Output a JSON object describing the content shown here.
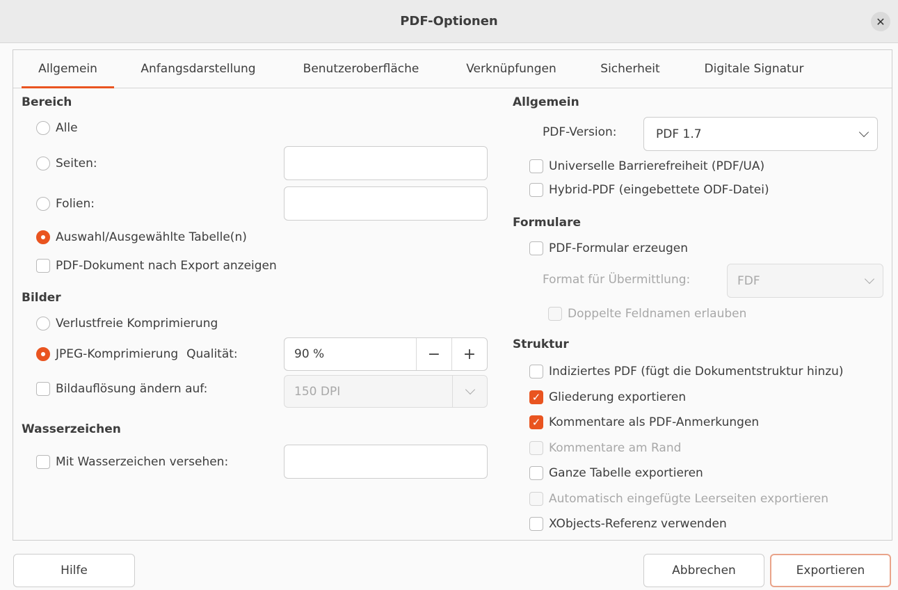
{
  "dialog": {
    "title": "PDF-Optionen"
  },
  "tabs": [
    "Allgemein",
    "Anfangsdarstellung",
    "Benutzeroberfläche",
    "Verknüpfungen",
    "Sicherheit",
    "Digitale Signatur"
  ],
  "bereich": {
    "heading": "Bereich",
    "all": "Alle",
    "pages": "Seiten:",
    "slides": "Folien:",
    "selection": "Auswahl/Ausgewählte Tabelle(n)",
    "show_after_export": "PDF-Dokument nach Export anzeigen",
    "selected": "selection"
  },
  "bilder": {
    "heading": "Bilder",
    "lossless": "Verlustfreie Komprimierung",
    "jpeg": "JPEG-Komprimierung",
    "quality_label": "Qualität:",
    "quality_value": "90 %",
    "minus": "−",
    "plus": "+",
    "resize_label": "Bildauflösung ändern auf:",
    "dpi_value": "150 DPI"
  },
  "wasserzeichen": {
    "heading": "Wasserzeichen",
    "label": "Mit Wasserzeichen versehen:"
  },
  "allgemein": {
    "heading": "Allgemein",
    "version_label": "PDF-Version:",
    "version_value": "PDF 1.7",
    "pdfua": "Universelle Barrierefreiheit (PDF/UA)",
    "hybrid": "Hybrid-PDF (eingebettete ODF-Datei)"
  },
  "formulare": {
    "heading": "Formulare",
    "create": "PDF-Formular erzeugen",
    "format_label": "Format für Übermittlung:",
    "format_value": "FDF",
    "duplicates": "Doppelte Feldnamen erlauben"
  },
  "struktur": {
    "heading": "Struktur",
    "tagged": "Indiziertes PDF (fügt die Dokumentstruktur hinzu)",
    "outline": "Gliederung exportieren",
    "comments": "Kommentare als PDF-Anmerkungen",
    "comments_margin": "Kommentare am Rand",
    "whole_sheet": "Ganze Tabelle exportieren",
    "blank_pages": "Automatisch eingefügte Leerseiten exportieren",
    "xobjects": "XObjects-Referenz verwenden"
  },
  "buttons": {
    "help": "Hilfe",
    "cancel": "Abbrechen",
    "export": "Exportieren"
  },
  "colors": {
    "accent": "#e95420"
  }
}
